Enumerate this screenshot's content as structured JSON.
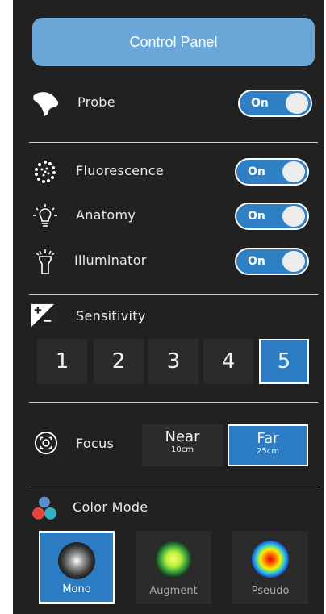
{
  "header": {
    "title": "Control Panel"
  },
  "probe": {
    "label": "Probe",
    "toggle": "On"
  },
  "channels": [
    {
      "label": "Fluorescence",
      "toggle": "On",
      "icon": "fluorescence-dots-icon"
    },
    {
      "label": "Anatomy",
      "toggle": "On",
      "icon": "lightbulb-icon"
    },
    {
      "label": "Illuminator",
      "toggle": "On",
      "icon": "flashlight-icon"
    }
  ],
  "sensitivity": {
    "label": "Sensitivity",
    "options": [
      "1",
      "2",
      "3",
      "4",
      "5"
    ],
    "selected": "5"
  },
  "focus": {
    "label": "Focus",
    "options": [
      {
        "main": "Near",
        "sub": "10cm"
      },
      {
        "main": "Far",
        "sub": "25cm"
      }
    ],
    "selected": "Far"
  },
  "color_mode": {
    "label": "Color Mode",
    "options": [
      "Mono",
      "Augment",
      "Pseudo"
    ],
    "selected": "Mono"
  },
  "colors": {
    "panel_bg": "#212121",
    "accent": "#2b7cc2",
    "header_bg": "#6aa6d8"
  }
}
